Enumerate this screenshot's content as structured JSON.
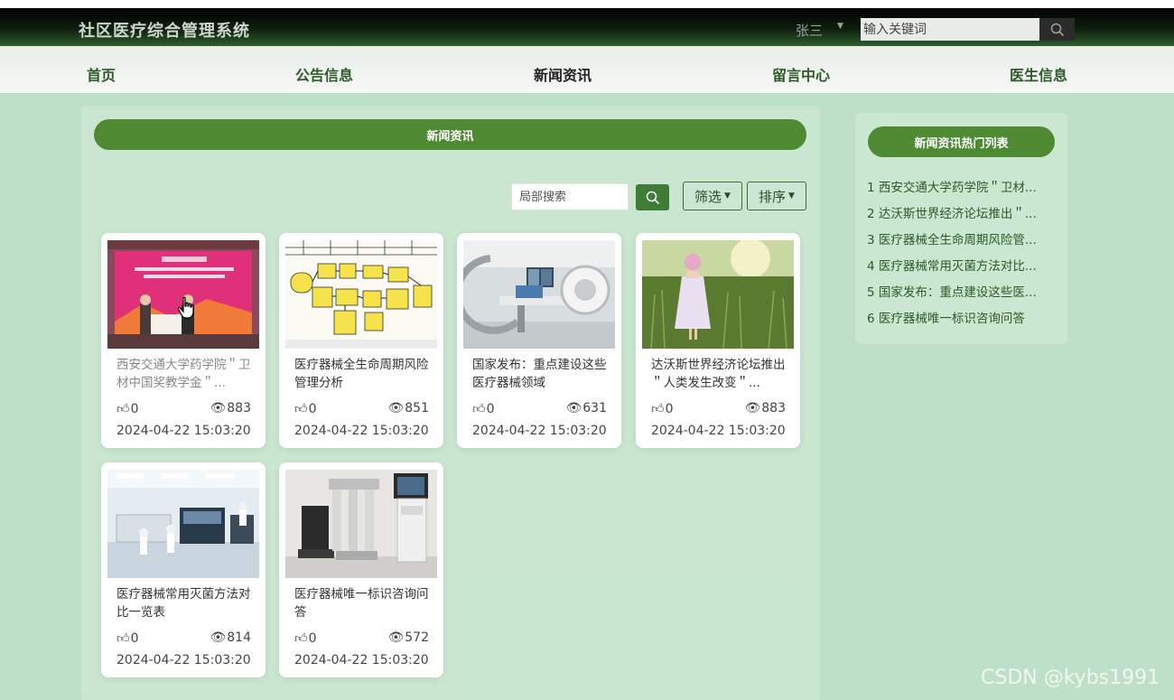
{
  "header": {
    "brand": "社区医疗综合管理系统",
    "user": "张三",
    "search_placeholder": "输入关键词"
  },
  "nav": [
    "首页",
    "公告信息",
    "新闻资讯",
    "留言中心",
    "医生信息"
  ],
  "main": {
    "section_title": "新闻资讯",
    "local_search_placeholder": "局部搜索",
    "filter_label": "筛选",
    "sort_label": "排序"
  },
  "cards": [
    {
      "title": "西安交通大学药学院＂卫材中国奖教学金＂...",
      "likes": "0",
      "views": "883",
      "date": "2024-04-22 15:03:20"
    },
    {
      "title": "医疗器械全生命周期风险管理分析",
      "likes": "0",
      "views": "851",
      "date": "2024-04-22 15:03:20"
    },
    {
      "title": "国家发布：重点建设这些医疗器械领域",
      "likes": "0",
      "views": "631",
      "date": "2024-04-22 15:03:20"
    },
    {
      "title": "达沃斯世界经济论坛推出＂人类发生改变＂...",
      "likes": "0",
      "views": "883",
      "date": "2024-04-22 15:03:20"
    },
    {
      "title": "医疗器械常用灭菌方法对比一览表",
      "likes": "0",
      "views": "814",
      "date": "2024-04-22 15:03:20"
    },
    {
      "title": "医疗器械唯一标识咨询问答",
      "likes": "0",
      "views": "572",
      "date": "2024-04-22 15:03:20"
    }
  ],
  "sidebar": {
    "title": "新闻资讯热门列表",
    "items": [
      "1  西安交通大学药学院＂卫材...",
      "2  达沃斯世界经济论坛推出＂...",
      "3  医疗器械全生命周期风险管...",
      "4  医疗器械常用灭菌方法对比...",
      "5  国家发布：重点建设这些医...",
      "6  医疗器械唯一标识咨询问答"
    ]
  },
  "watermark": "CSDN @kybs1991",
  "colors": {
    "accent": "#4e8a32",
    "nav_text": "#2d5a27",
    "background": "#bfe0c8"
  }
}
